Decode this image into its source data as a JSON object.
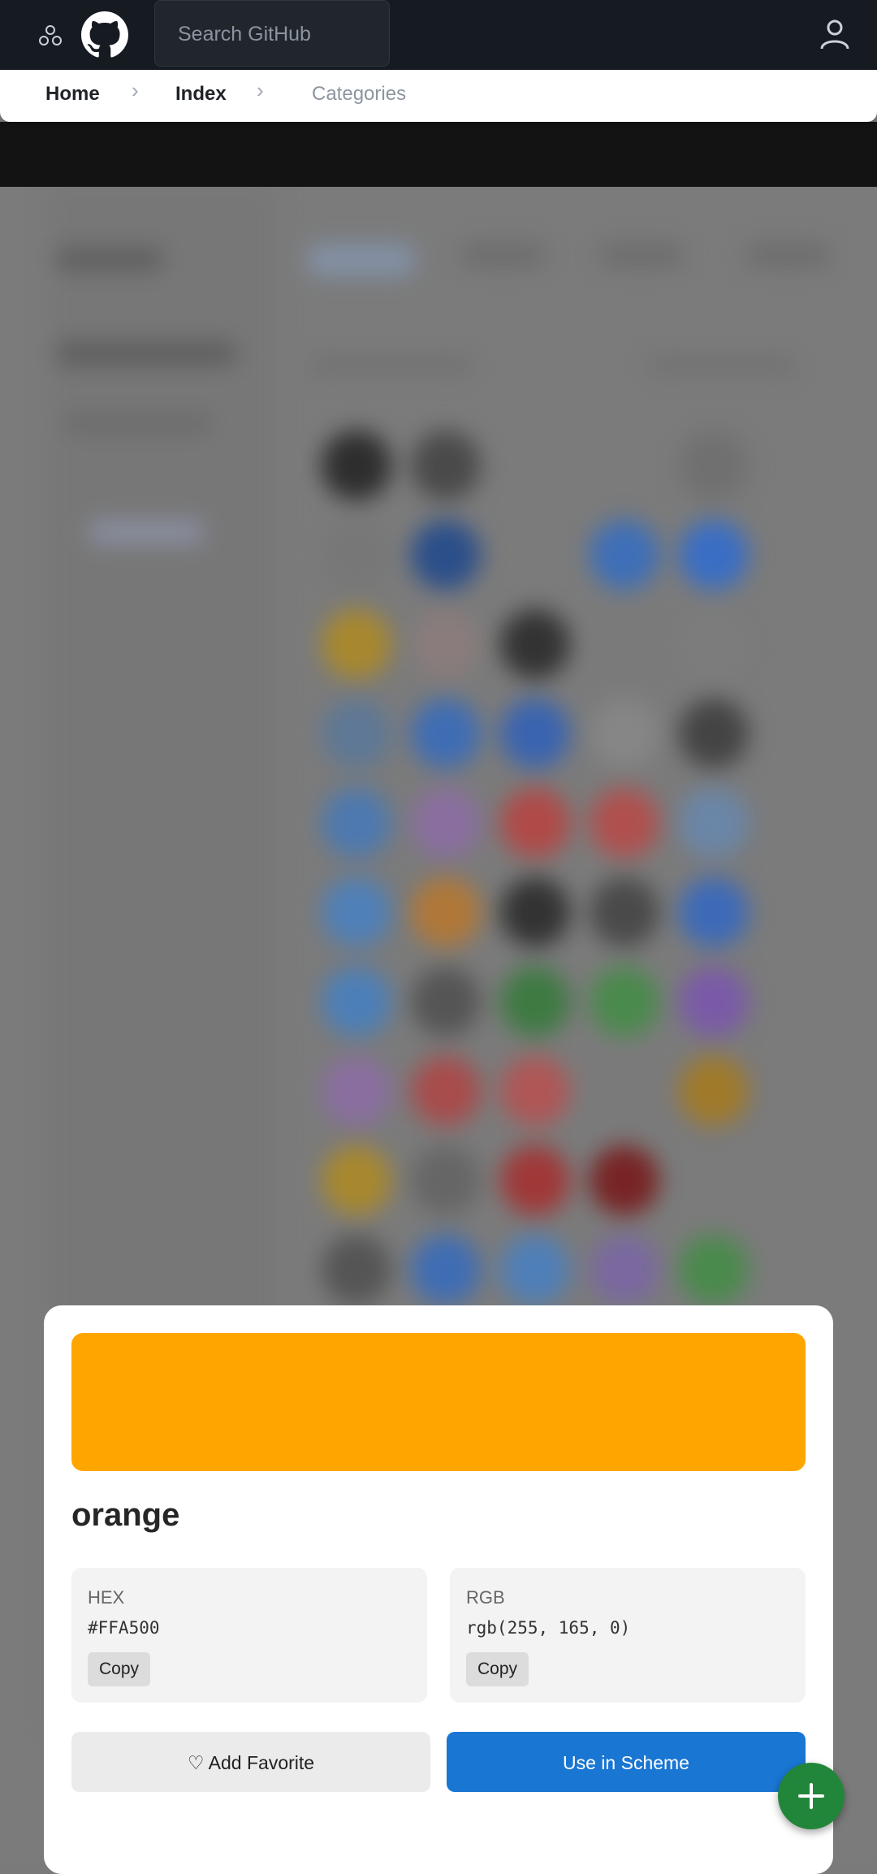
{
  "header": {
    "search_placeholder": "Search GitHub",
    "icons": [
      "menu-icon",
      "github-logo-icon",
      "user-icon"
    ]
  },
  "breadcrumb": {
    "items": [
      {
        "label": "Home"
      },
      {
        "label": "Index"
      },
      {
        "label": "Categories"
      }
    ]
  },
  "color": {
    "name": "orange",
    "hex_label": "HEX",
    "hex_value": "#FFA500",
    "rgb_label": "RGB",
    "rgb_value": "rgb(255, 165, 0)",
    "copy_label": "Copy",
    "swatch": "#FFA500"
  },
  "actions": {
    "favorite_label": "♡ Add Favorite",
    "use_label": "Use in Scheme"
  },
  "fab": {
    "icon": "plus-icon"
  },
  "colors": {
    "header_bg": "#161b22",
    "primary_button": "#1976d2",
    "fab": "#22863a"
  }
}
